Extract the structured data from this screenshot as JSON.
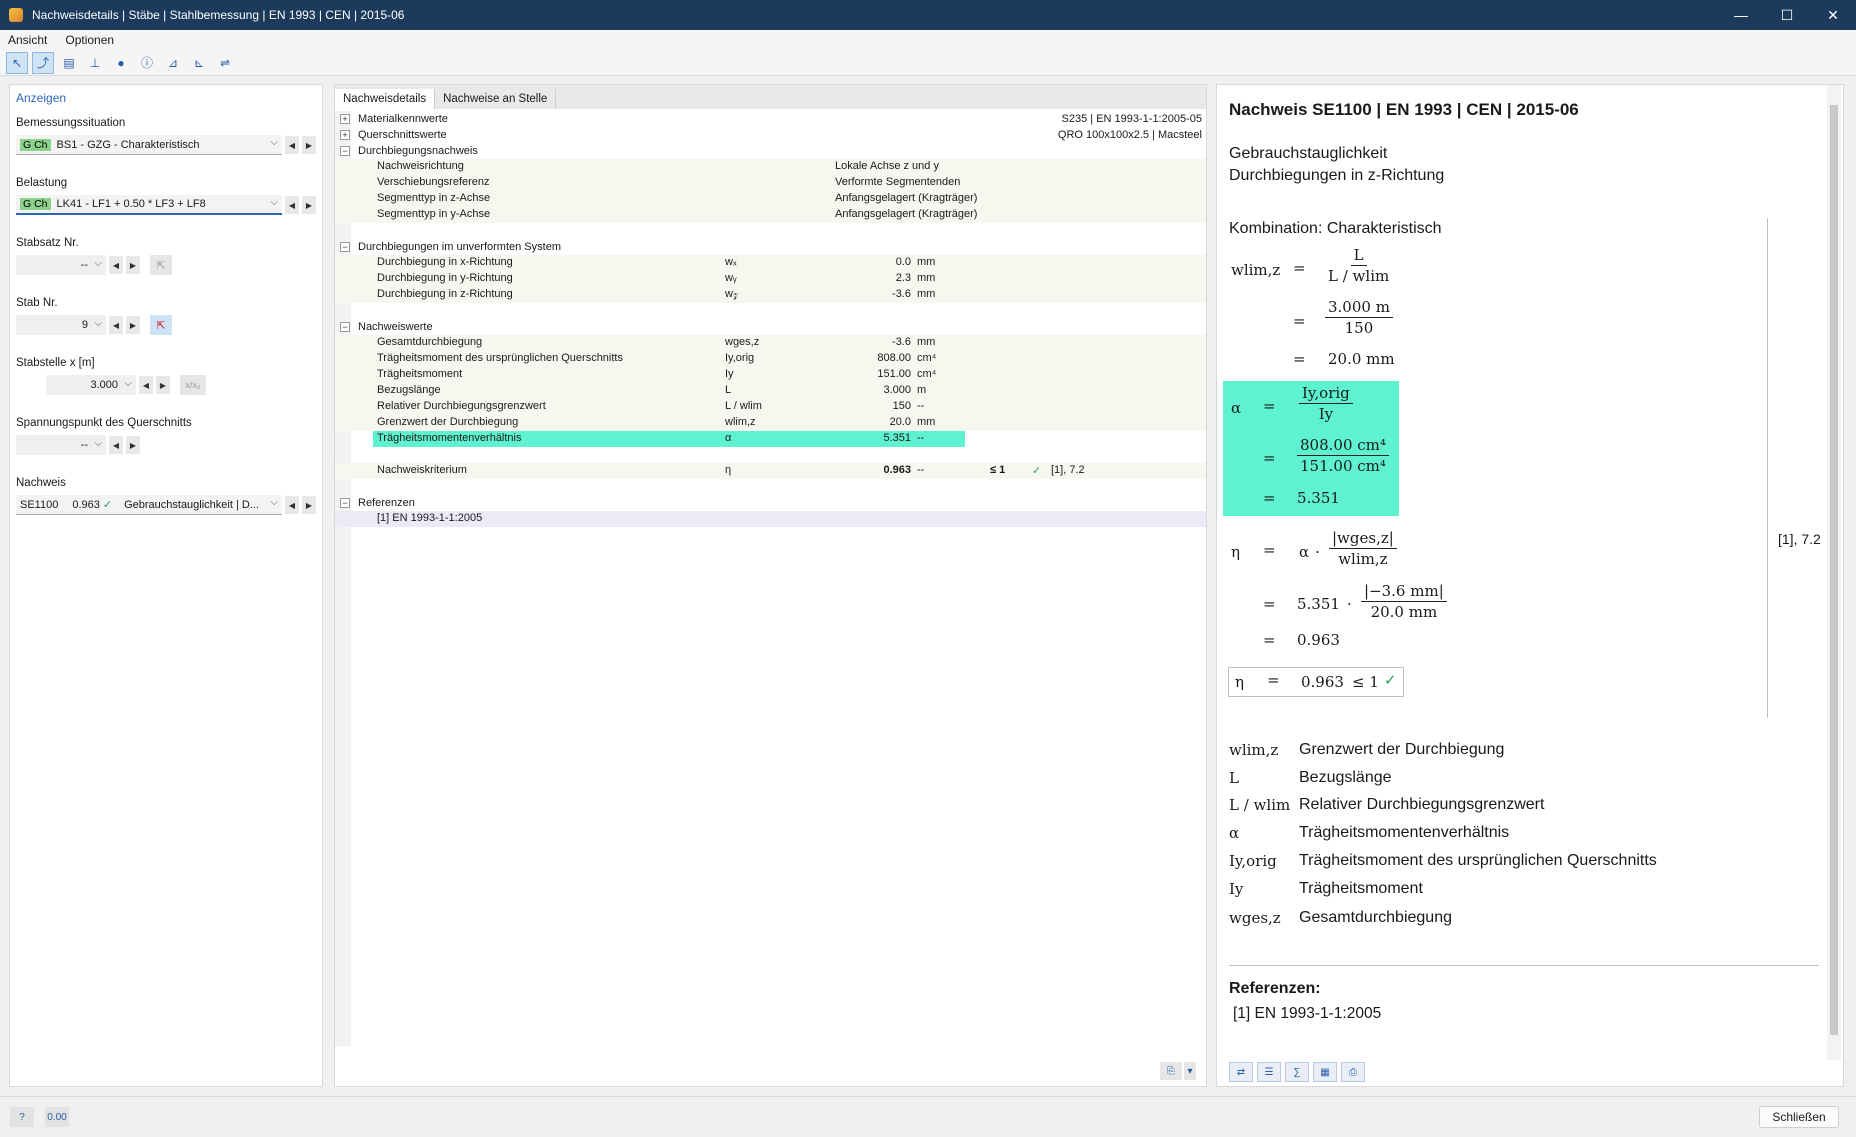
{
  "window": {
    "title": "Nachweisdetails | Stäbe | Stahlbemessung | EN 1993 | CEN | 2015-06",
    "minimize": "—",
    "maximize": "☐",
    "close": "✕"
  },
  "menu": [
    "Ansicht",
    "Optionen"
  ],
  "left": {
    "header": "Anzeigen",
    "design_situation": {
      "label": "Bemessungssituation",
      "tag": "G Ch",
      "value": "BS1 - GZG - Charakteristisch"
    },
    "load": {
      "label": "Belastung",
      "tag": "G Ch",
      "value": "LK41 - LF1 + 0.50 * LF3 + LF8"
    },
    "member_set": {
      "label": "Stabsatz Nr.",
      "value": "--"
    },
    "member": {
      "label": "Stab Nr.",
      "value": "9"
    },
    "location": {
      "label": "Stabstelle x [m]",
      "value": "3.000",
      "rel": "x/x₀"
    },
    "stress_point": {
      "label": "Spannungspunkt des Querschnitts",
      "value": "--"
    },
    "check": {
      "label": "Nachweis",
      "id": "SE1100",
      "ratio": "0.963",
      "ok": "✓",
      "type": "Gebrauchstauglichkeit | D..."
    }
  },
  "middle": {
    "tabs": [
      "Nachweisdetails",
      "Nachweise an Stelle"
    ],
    "material": {
      "label": "Materialkennwerte",
      "value": "S235 | EN 1993-1-1:2005-05"
    },
    "section": {
      "label": "Querschnittswerte",
      "value": "QRO 100x100x2.5 | Macsteel"
    },
    "deflection_check": {
      "label": "Durchbiegungsnachweis",
      "rows": [
        {
          "name": "Nachweisrichtung",
          "value": "Lokale Achse z und y"
        },
        {
          "name": "Verschiebungsreferenz",
          "value": "Verformte Segmentenden"
        },
        {
          "name": "Segmenttyp in z-Achse",
          "value": "Anfangsgelagert (Kragträger)"
        },
        {
          "name": "Segmenttyp in y-Achse",
          "value": "Anfangsgelagert (Kragträger)"
        }
      ]
    },
    "undeformed": {
      "label": "Durchbiegungen im unverformten System",
      "rows": [
        {
          "name": "Durchbiegung in x-Richtung",
          "sym": "wₓ",
          "value": "0.0",
          "unit": "mm"
        },
        {
          "name": "Durchbiegung in y-Richtung",
          "sym": "wᵧ",
          "value": "2.3",
          "unit": "mm"
        },
        {
          "name": "Durchbiegung in z-Richtung",
          "sym": "w𝓏",
          "value": "-3.6",
          "unit": "mm"
        }
      ]
    },
    "check_values": {
      "label": "Nachweiswerte",
      "rows": [
        {
          "name": "Gesamtdurchbiegung",
          "sym": "wges,z",
          "value": "-3.6",
          "unit": "mm"
        },
        {
          "name": "Trägheitsmoment des ursprünglichen Querschnitts",
          "sym": "Iy,orig",
          "value": "808.00",
          "unit": "cm⁴"
        },
        {
          "name": "Trägheitsmoment",
          "sym": "Iy",
          "value": "151.00",
          "unit": "cm⁴"
        },
        {
          "name": "Bezugslänge",
          "sym": "L",
          "value": "3.000",
          "unit": "m"
        },
        {
          "name": "Relativer Durchbiegungsgrenzwert",
          "sym": "L / wlim",
          "value": "150",
          "unit": "--"
        },
        {
          "name": "Grenzwert der Durchbiegung",
          "sym": "wlim,z",
          "value": "20.0",
          "unit": "mm"
        },
        {
          "name": "Trägheitsmomentenverhältnis",
          "sym": "α",
          "value": "5.351",
          "unit": "--"
        }
      ],
      "criterion": {
        "name": "Nachweiskriterium",
        "sym": "η",
        "value": "0.963",
        "unit": "--",
        "limit": "≤ 1",
        "ok": "✓",
        "ref": "[1], 7.2"
      }
    },
    "references": {
      "label": "Referenzen",
      "item": "[1]  EN 1993-1-1:2005"
    }
  },
  "right": {
    "title": "Nachweis SE1100 | EN 1993 | CEN | 2015-06",
    "sub1": "Gebrauchstauglichkeit",
    "sub2": "Durchbiegungen in z-Richtung",
    "combination": "Kombination: Charakteristisch",
    "w_sym": "wlim,z",
    "eq": "=",
    "f1_num": "L",
    "f1_den": "L / wlim",
    "f2_num": "3.000 m",
    "f2_den": "150",
    "w_res": "20.0 mm",
    "alpha": "α",
    "a_num": "Iy,orig",
    "a_den": "Iy",
    "a2_num": "808.00 cm⁴",
    "a2_den": "151.00 cm⁴",
    "a_res": "5.351",
    "eta": "η",
    "e_num": "|wges,z|",
    "e_den": "wlim,z",
    "e2_coef": "5.351",
    "e2_num": "|−3.6 mm|",
    "e2_den": "20.0 mm",
    "e_res": "0.963",
    "final": "0.963",
    "final_lim": "≤ 1",
    "final_ok": "✓",
    "dot": "·",
    "side_ref": "[1], 7.2",
    "legend": [
      {
        "sym": "wlim,z",
        "text": "Grenzwert der Durchbiegung"
      },
      {
        "sym": "L",
        "text": "Bezugslänge"
      },
      {
        "sym": "L / wlim",
        "text": "Relativer Durchbiegungsgrenzwert"
      },
      {
        "sym": "α",
        "text": "Trägheitsmomentenverhältnis"
      },
      {
        "sym": "Iy,orig",
        "text": "Trägheitsmoment des ursprünglichen Querschnitts"
      },
      {
        "sym": "Iy",
        "text": "Trägheitsmoment"
      },
      {
        "sym": "wges,z",
        "text": "Gesamtdurchbiegung"
      }
    ],
    "refs_title": "Referenzen:",
    "ref1": "[1]    EN 1993-1-1:2005"
  },
  "footer": {
    "close": "Schließen",
    "calc_icon": "0.00"
  },
  "colors": {
    "highlight": "#5ef2d0",
    "titlebar": "#1b3a5c",
    "accent": "#2b67b5"
  }
}
